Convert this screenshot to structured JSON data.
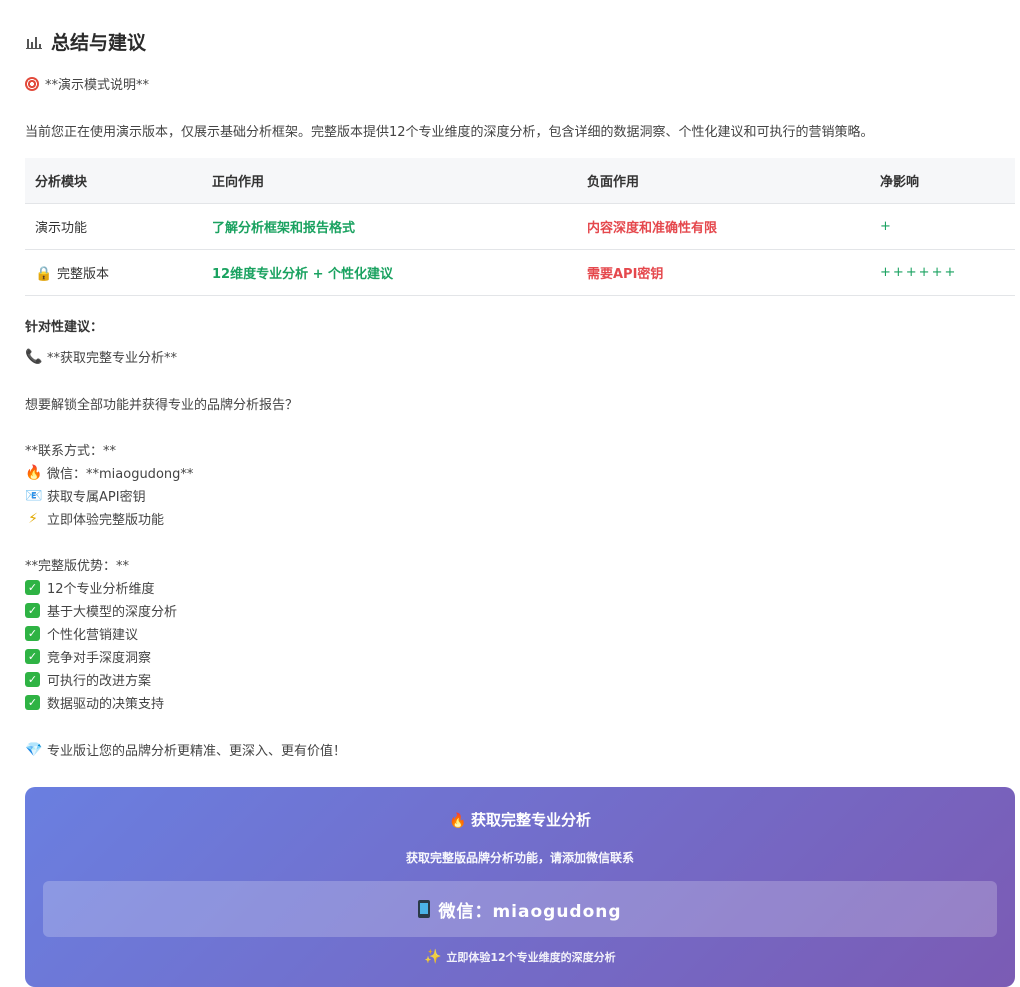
{
  "heading": {
    "title": "总结与建议",
    "icon": "bar-chart-icon"
  },
  "demo_note": {
    "icon": "target-icon",
    "label": "**演示模式说明**"
  },
  "intro": "当前您正在使用演示版本，仅展示基础分析框架。完整版本提供12个专业维度的深度分析，包含详细的数据洞察、个性化建议和可执行的营销策略。",
  "table": {
    "headers": [
      "分析模块",
      "正向作用",
      "负面作用",
      "净影响"
    ],
    "rows": [
      {
        "module": "演示功能",
        "icon": "",
        "positive": "了解分析框架和报告格式",
        "negative": "内容深度和准确性有限",
        "net": "+"
      },
      {
        "module": "完整版本",
        "icon": "lock-icon",
        "positive": "12维度专业分析 + 个性化建议",
        "negative": "需要API密钥",
        "net": "++++++"
      }
    ]
  },
  "advice": {
    "title": "针对性建议：",
    "get_full": "**获取完整专业分析**",
    "question": "想要解锁全部功能并获得专业的品牌分析报告？",
    "contact_title": "**联系方式：**",
    "contact_lines": [
      {
        "icon": "fire-icon",
        "text": "微信：**miaogudong**"
      },
      {
        "icon": "envelope-icon",
        "text": "获取专属API密钥"
      },
      {
        "icon": "lightning-icon",
        "text": "立即体验完整版功能"
      }
    ],
    "advantages_title": "**完整版优势：**",
    "advantages": [
      "12个专业分析维度",
      "基于大模型的深度分析",
      "个性化营销建议",
      "竞争对手深度洞察",
      "可执行的改进方案",
      "数据驱动的决策支持"
    ],
    "closing": "专业版让您的品牌分析更精准、更深入、更有价值！"
  },
  "banner": {
    "title": "获取完整专业分析",
    "subtitle": "获取完整版品牌分析功能，请添加微信联系",
    "wechat": "微信：miaogudong",
    "footer": "立即体验12个专业维度的深度分析",
    "gradient_start": "#6a7fe0",
    "gradient_end": "#7b5bb4"
  },
  "colors": {
    "positive": "#1aa260",
    "negative": "#e5484d",
    "check": "#2fb344"
  }
}
